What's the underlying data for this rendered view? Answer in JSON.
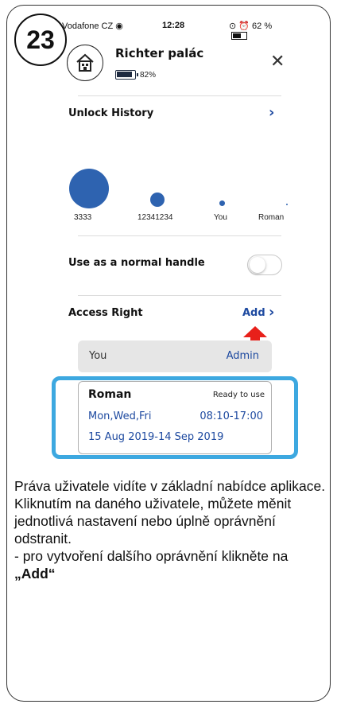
{
  "step_number": "23",
  "status_bar": {
    "carrier": "Vodafone CZ",
    "time": "12:28",
    "battery": "62 %"
  },
  "header": {
    "title": "Richter palác",
    "battery_level": "82%",
    "close_icon": "close-icon"
  },
  "unlock_history": {
    "label": "Unlock History",
    "users": [
      {
        "name": "3333"
      },
      {
        "name": "12341234"
      },
      {
        "name": "You"
      },
      {
        "name": "Roman"
      }
    ]
  },
  "normal_handle": {
    "label": "Use as a normal handle",
    "enabled": false
  },
  "access_right": {
    "label": "Access Right",
    "add_label": "Add",
    "entries": [
      {
        "name": "You",
        "role": "Admin"
      },
      {
        "name": "Roman",
        "status": "Ready to use",
        "days": "Mon,Wed,Fri",
        "time": "08:10-17:00",
        "dates": "15 Aug 2019-14 Sep 2019"
      }
    ]
  },
  "caption": {
    "line1": "Práva uživatele vidíte v základní nabídce aplikace.",
    "line2": "Kliknutím na daného uživatele, můžete měnit jednotlivá nastavení nebo úplně oprávnění odstranit.",
    "line3_prefix": "-    pro vytvoření dalšího oprávnění klikněte na ",
    "line3_bold": "„Add“"
  },
  "colors": {
    "accent": "#2e63b0",
    "link": "#1e4aa0",
    "highlight": "#3da8e0",
    "arrow": "#e8201a"
  }
}
